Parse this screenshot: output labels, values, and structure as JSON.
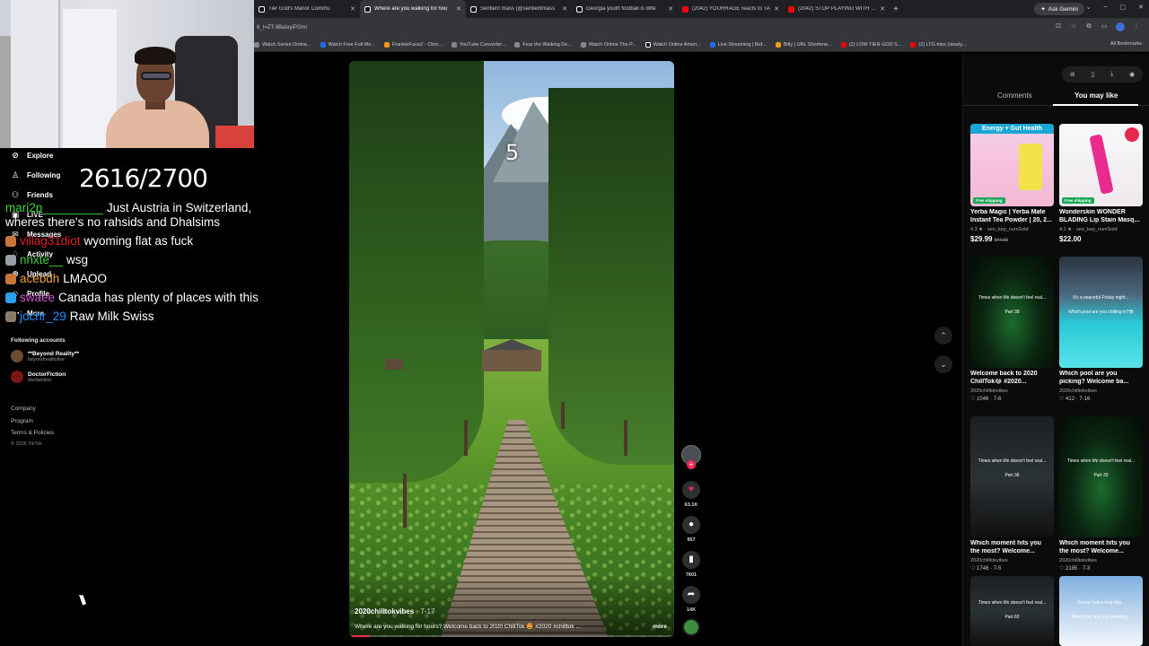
{
  "browser": {
    "tabs": [
      {
        "title": "Tier God's Manor Commu",
        "icon": "tiktok-icon",
        "active": false
      },
      {
        "title": "Where are you walking for hou",
        "icon": "tiktok-icon",
        "active": true
      },
      {
        "title": "Sentient mass (@sentientmass",
        "icon": "tiktok-icon",
        "active": false
      },
      {
        "title": "Georgia youth football is diffe",
        "icon": "tiktok-icon",
        "active": false
      },
      {
        "title": "(2042) YOURRAGE reacts to TA",
        "icon": "youtube-icon",
        "active": false
      },
      {
        "title": "(2042) STOP PLAYING WITH US",
        "icon": "youtube-icon",
        "active": false
      }
    ],
    "new_tab": "+",
    "gemini_label": "Ask Gemini",
    "url": "8_t=ZT-9BaIoyiPGmr",
    "bookmarks": [
      "Watch Series Online...",
      "Watch Free Full Mo...",
      "FrankerFaceZ - Chro...",
      "YouTube Converter...",
      "Fear the Walking De...",
      "Watch Online The P...",
      "Watch Online Ameri...",
      "Live Streaming | Buf...",
      "Bitly | URL Shortene...",
      "(2) LOW TIER GOD S...",
      "(2) LTG tries (slowly..."
    ],
    "all_bookmarks": "All Bookmarks"
  },
  "sidebar": {
    "nav": [
      {
        "label": "Explore",
        "icon": "compass-icon"
      },
      {
        "label": "Following",
        "icon": "following-icon"
      },
      {
        "label": "Friends",
        "icon": "friends-icon"
      },
      {
        "label": "LIVE",
        "icon": "live-icon"
      },
      {
        "label": "Messages",
        "icon": "messages-icon"
      },
      {
        "label": "Activity",
        "icon": "activity-icon"
      },
      {
        "label": "Upload",
        "icon": "upload-icon"
      },
      {
        "label": "Profile",
        "icon": "profile-icon"
      },
      {
        "label": "More",
        "icon": "more-icon"
      }
    ],
    "following_title": "Following accounts",
    "following": [
      {
        "name": "**Beyond Reality**",
        "handle": "beyondrealitylive"
      },
      {
        "name": "DoctorFiction",
        "handle": "docfaiction"
      }
    ],
    "footer": [
      "Company",
      "Program",
      "Terms & Policies"
    ],
    "copyright": "© 2026 TikTok"
  },
  "stream": {
    "counter": "2616/2700",
    "chat": [
      {
        "user": "mari2p_________",
        "user_color": "#3fd33f",
        "message": "Just Austria in Switzerland,",
        "badge": ""
      },
      {
        "user": "",
        "user_color": "#ffffff",
        "message": "wheres there's no rahsids and Dhalsims",
        "badge": ""
      },
      {
        "user": "villag31diot",
        "user_color": "#e02020",
        "message": "wyoming flat as fuck",
        "badge": "#c8763a"
      },
      {
        "user": "nnxte__",
        "user_color": "#3fd33f",
        "message": "wsg",
        "badge": "#9a9ea6"
      },
      {
        "user": "acebdh",
        "user_color": "#e8a33c",
        "message": "LMAOO",
        "badge": "#c8763a"
      },
      {
        "user": "swaee",
        "user_color": "#d45ad8",
        "message": "Canada has plenty of places with this",
        "badge": "#2aa0f0"
      },
      {
        "user": "jochr_29",
        "user_color": "#1e90ff",
        "message": "Raw Milk Swiss",
        "badge": "#8a7a6a"
      }
    ]
  },
  "video": {
    "overlay_number": "5",
    "author": "2020chilltokvibes",
    "date": "· 7-17",
    "caption": "Where are you walking for hours? Welcome back to 2020 ChillTok 🤩 #2020 #chilltok ...",
    "more": "more",
    "progress": 0.06,
    "actions": {
      "likes": "63.1K",
      "comments": "957",
      "saves": "7601",
      "shares": "14K"
    }
  },
  "right_panel": {
    "tabs": [
      "Comments",
      "You may like"
    ],
    "active_tab": "You may like",
    "cards": [
      {
        "thumb_text": "Energy + Gut Health",
        "title": "Yerba Magic | Yerba Mate",
        "title2": "Instant Tea Powder | 20, 2...",
        "meta": "4.3 ★ · seo_kep_numSold",
        "price": "$29.99",
        "old_price": "$44.99",
        "badge": "Free shipping",
        "kind": "product-yerba"
      },
      {
        "thumb_text": "",
        "title": "Wonderskin WONDER",
        "title2": "BLADING Lip Stain Masqu...",
        "meta": "4.2 ★ · seo_kep_numSold",
        "price": "$22.00",
        "old_price": "",
        "badge": "Free shipping",
        "kind": "product-lip"
      },
      {
        "thumb_text": "Times when life doesn't feel real...",
        "sub": "Part 38",
        "title": "Welcome back to 2020",
        "title2": "ChillTok😂 #2020...",
        "meta": "2020chilltokvibes",
        "stats": "♡ 1046 · 7-6",
        "kind": "video-green"
      },
      {
        "thumb_text": "It's a peaceful Friday night...",
        "sub": "Which pool are you chilling in?😎",
        "title": "Which pool are you",
        "title2": "picking? Welcome ba...",
        "meta": "2020chilltokvibes",
        "stats": "♡ 412 · 7-16",
        "kind": "video-pool"
      },
      {
        "thumb_text": "Times when life doesn't feel real...",
        "sub": "Part 36",
        "title": "Which moment hits you",
        "title2": "the most? Welcome...",
        "meta": "2020chilltokvibes",
        "stats": "♡ 1746 · 7-5",
        "kind": "video-dark"
      },
      {
        "thumb_text": "Times when life doesn't feel real...",
        "sub": "Part 30",
        "title": "Which moment hits you",
        "title2": "the most? Welcome...",
        "meta": "2020chilltokvibes",
        "stats": "♡ 2185 · 7-3",
        "kind": "video-green"
      },
      {
        "thumb_text": "Times when life doesn't feel real...",
        "sub": "Part 60",
        "title": "",
        "title2": "",
        "meta": "",
        "stats": "",
        "kind": "video-dark"
      },
      {
        "thumb_text": "You've had a long day...",
        "sub": "Which bed are you sleeping...",
        "title": "",
        "title2": "",
        "meta": "",
        "stats": "",
        "kind": "video-snow"
      }
    ]
  },
  "colors": {
    "accent": "#fe2c55",
    "background": "#000000",
    "panel": "#0b0b0b"
  }
}
